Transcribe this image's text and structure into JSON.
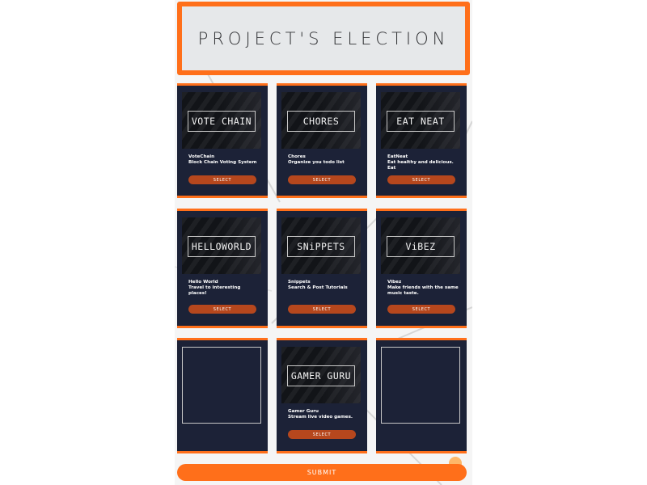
{
  "header": {
    "title": "PROJECT'S ELECTION"
  },
  "projects": [
    {
      "logo": "VOTE CHAIN",
      "title": "VoteChain",
      "desc": "Block Chain Voting System",
      "select": "SELECT"
    },
    {
      "logo": "CHORES",
      "title": "Chores",
      "desc": "Organize you todo list",
      "select": "SELECT"
    },
    {
      "logo": "EAT NEAT",
      "title": "EatNeat",
      "desc": "Eat healthy and delicious. Eat",
      "select": "SELECT"
    },
    {
      "logo": "HELLOWORLD",
      "title": "Hello World",
      "desc": "Travel to interesting places!",
      "select": "SELECT"
    },
    {
      "logo": "SNiPPETS",
      "title": "Snippets",
      "desc": "Search & Post Tutorials",
      "select": "SELECT"
    },
    {
      "logo": "ViBEZ",
      "title": "Vibez",
      "desc": "Make friends with the same music taste.",
      "select": "SELECT"
    },
    {
      "logo": "GAMER GURU",
      "title": "Gamer Guru",
      "desc": "Stream live video games.",
      "select": "SELECT"
    }
  ],
  "submit_label": "SUBMIT",
  "colors": {
    "accent": "#ff6f1a",
    "card_bg": "#1c2237",
    "select_btn": "#b6471d"
  }
}
